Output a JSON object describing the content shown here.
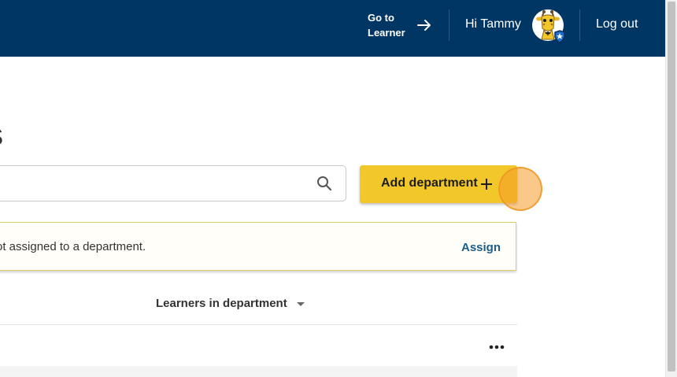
{
  "header": {
    "goto_label": "Go to Learner",
    "greeting": "Hi Tammy",
    "logout": "Log out",
    "colors": {
      "bar": "#003663",
      "accent": "#f2c72a"
    }
  },
  "page": {
    "title_fragment": "S"
  },
  "search": {
    "value": "",
    "placeholder": "",
    "icon": "search-icon"
  },
  "add_button": {
    "label": "Add department",
    "icon": "plus-icon"
  },
  "notice": {
    "text": "ot assigned to a department.",
    "action": "Assign"
  },
  "table": {
    "column_header": "Learners in department",
    "row_actions_icon": "more-horizontal-icon"
  }
}
